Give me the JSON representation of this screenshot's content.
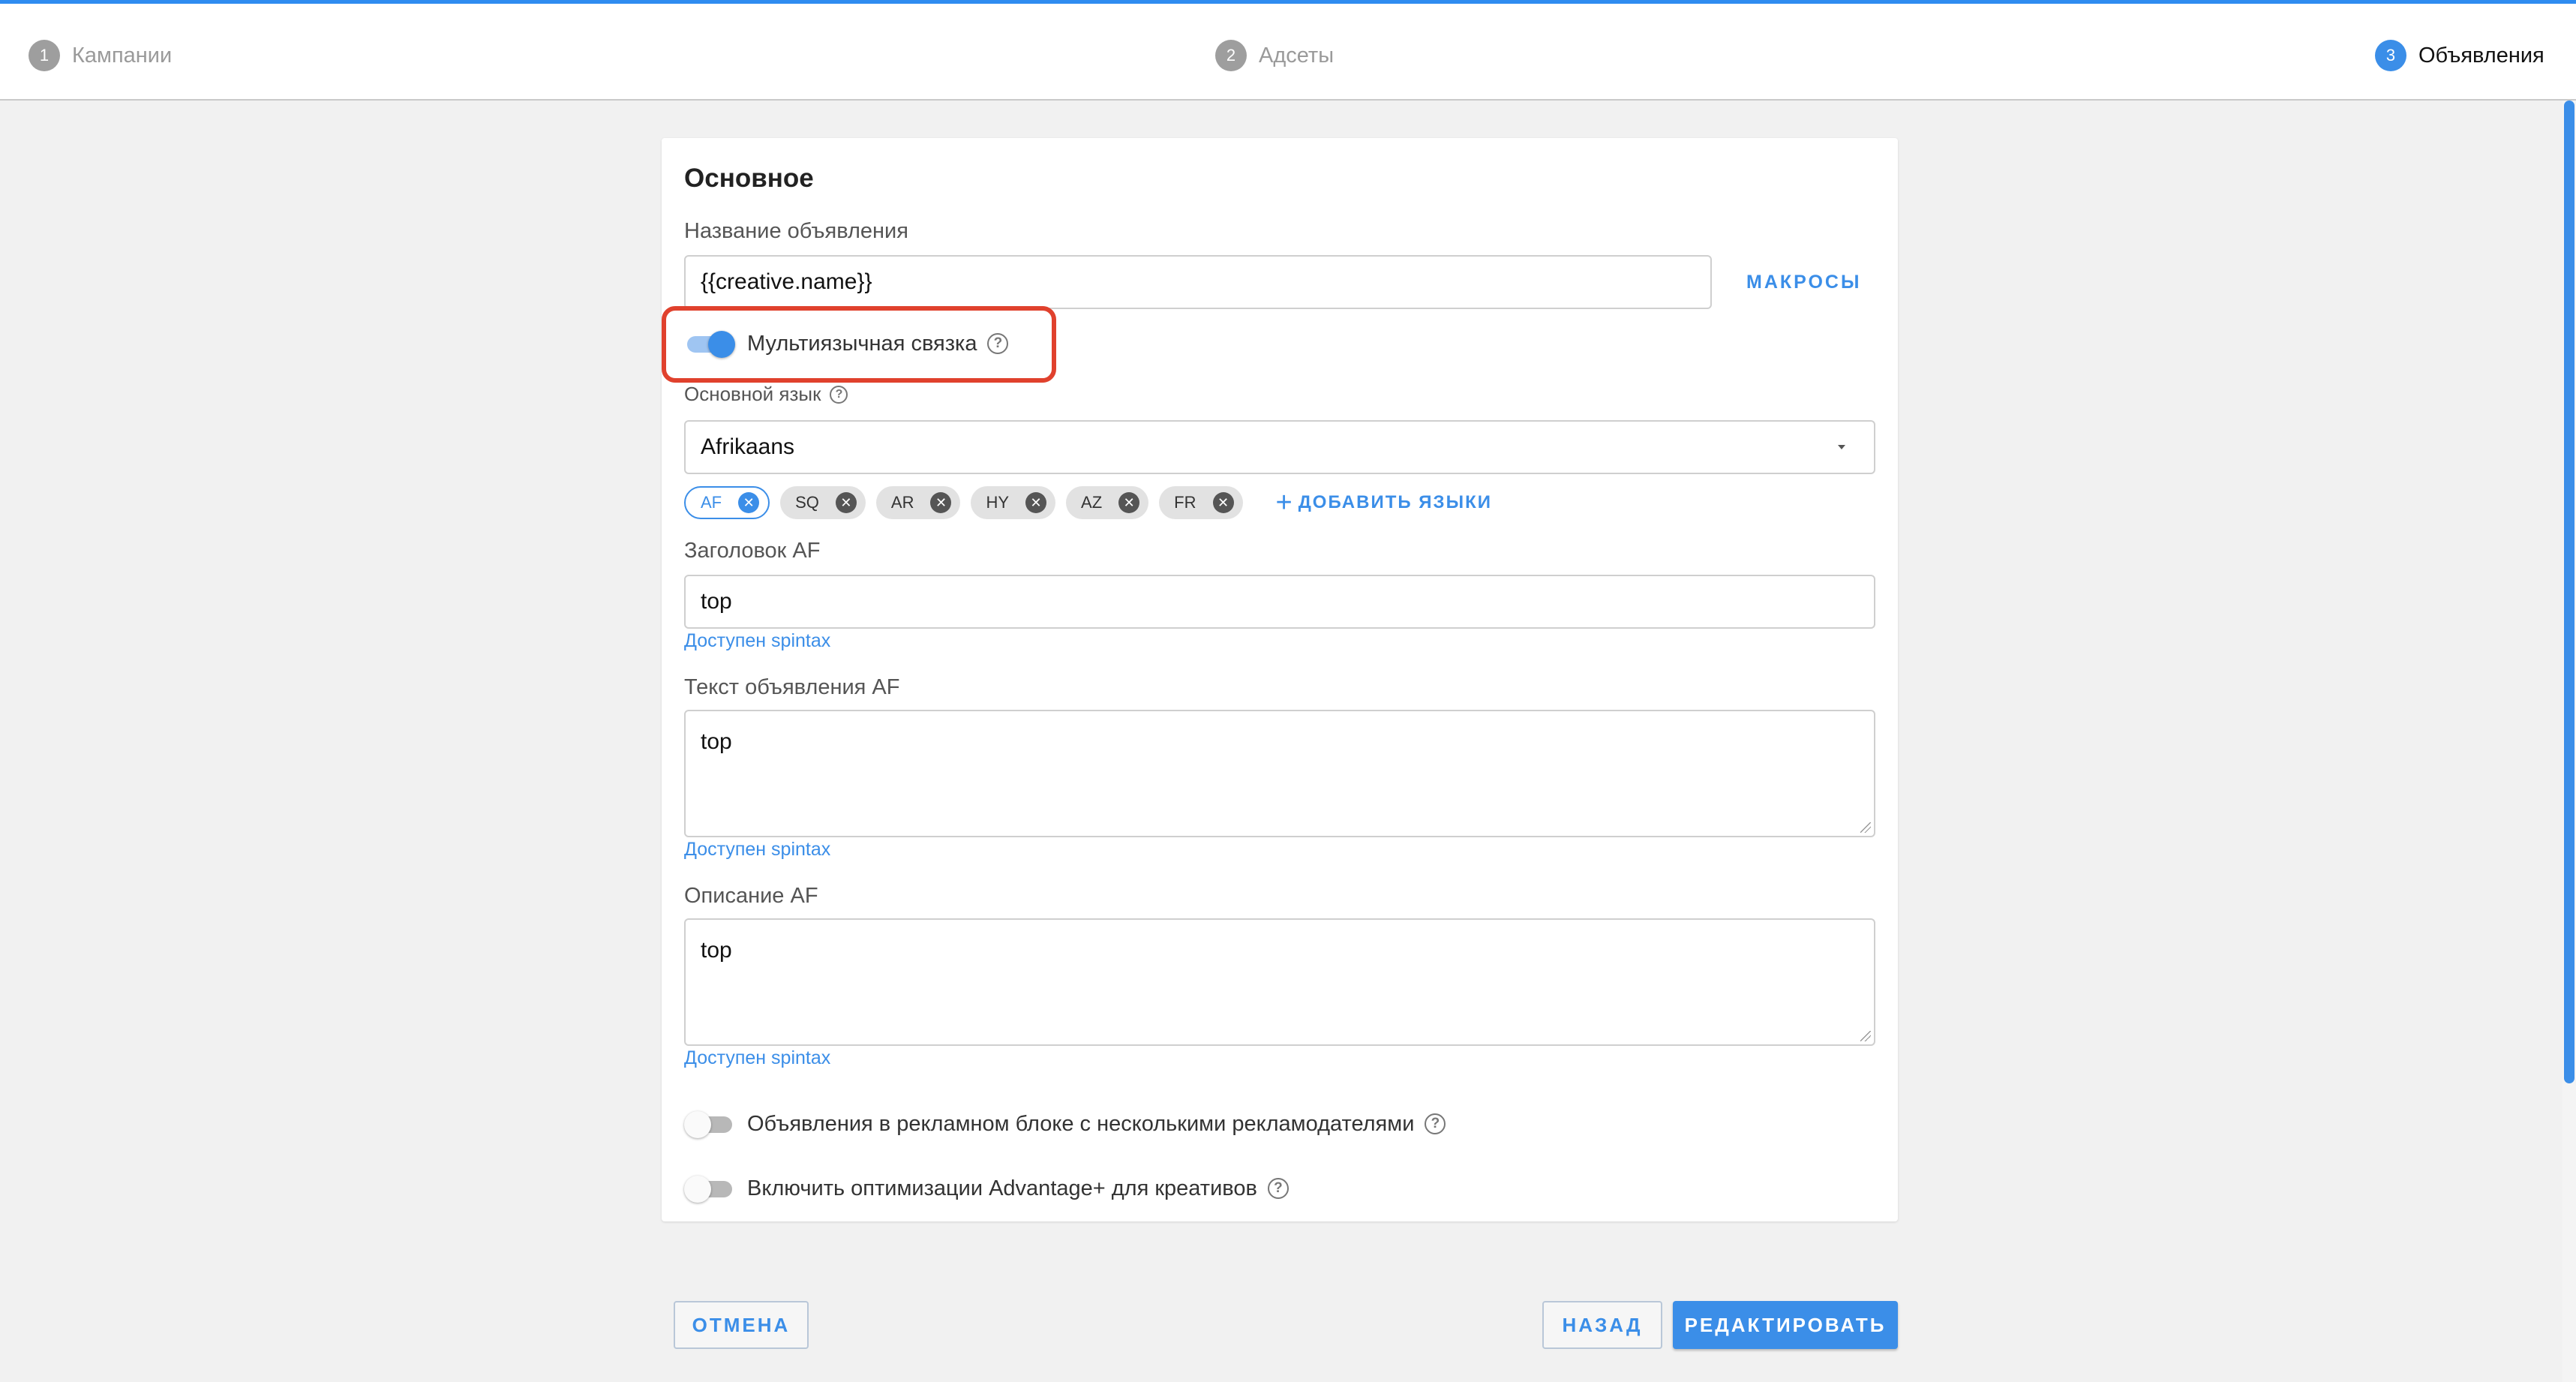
{
  "stepper": {
    "steps": [
      {
        "num": "1",
        "label": "Кампании"
      },
      {
        "num": "2",
        "label": "Адсеты"
      },
      {
        "num": "3",
        "label": "Объявления"
      }
    ]
  },
  "card": {
    "title": "Основное",
    "ad_name": {
      "label": "Название объявления",
      "value": "{{creative.name}}"
    },
    "macros_label": "МАКРОСЫ",
    "multilang": {
      "label": "Мультиязычная связка",
      "enabled": true
    },
    "main_language": {
      "label": "Основной язык",
      "value": "Afrikaans"
    },
    "languages": [
      "AF",
      "SQ",
      "AR",
      "HY",
      "AZ",
      "FR"
    ],
    "add_languages_label": "ДОБАВИТЬ ЯЗЫКИ",
    "headline": {
      "label": "Заголовок AF",
      "value": "top",
      "hint": "Доступен spintax"
    },
    "ad_text": {
      "label": "Текст объявления AF",
      "value": "top",
      "hint": "Доступен spintax"
    },
    "description": {
      "label": "Описание AF",
      "value": "top",
      "hint": "Доступен spintax"
    },
    "multi_advertiser": {
      "label": "Объявления в рекламном блоке с несколькими рекламодателями",
      "enabled": false
    },
    "advantage": {
      "label": "Включить оптимизации Advantage+ для креативов",
      "enabled": false
    }
  },
  "footer": {
    "cancel": "ОТМЕНА",
    "back": "НАЗАД",
    "edit": "РЕДАКТИРОВАТЬ"
  },
  "colors": {
    "accent": "#3b8ee8",
    "highlight": "#e0412d"
  }
}
